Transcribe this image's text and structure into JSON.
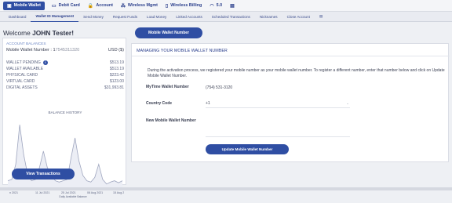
{
  "top_nav": {
    "items": [
      {
        "icon": "wallet-icon",
        "glyph": "▣",
        "label": "Mobile Wallet",
        "active": true
      },
      {
        "icon": "card-icon",
        "glyph": "▭",
        "label": "Debit Card"
      },
      {
        "icon": "lock-icon",
        "glyph": "🔒",
        "label": "Account"
      },
      {
        "icon": "signal-icon",
        "glyph": "⁂",
        "label": "Wireless Mgmt"
      },
      {
        "icon": "phone-icon",
        "glyph": "▯",
        "label": "Wireless Billing"
      },
      {
        "icon": "wifi-icon",
        "glyph": "◠",
        "label": "5.0"
      },
      {
        "icon": "chat-icon",
        "glyph": "▤",
        "label": ""
      }
    ]
  },
  "sub_nav": {
    "items": [
      {
        "label": "Dashboard"
      },
      {
        "label": "Wallet ID Management",
        "active": true
      },
      {
        "label": "Send Money"
      },
      {
        "label": "Request Funds"
      },
      {
        "label": "Load Money"
      },
      {
        "label": "Linked Accounts"
      },
      {
        "label": "Scheduled Transactions"
      },
      {
        "label": "Nicknames"
      },
      {
        "label": "Close Account"
      },
      {
        "label": "▤",
        "icon": "chat-icon"
      }
    ]
  },
  "welcome": {
    "prefix": "Welcome ",
    "name": "JOHN Tester!"
  },
  "balances": {
    "heading": "ACCOUNT BALANCES",
    "mobile_wallet_label": "Mobile Wallet Number : 1",
    "mobile_wallet_value": "7545311320",
    "currency": "USD ($)",
    "rows": [
      {
        "label": "WALLET PENDING",
        "value": "$513.19",
        "info": true
      },
      {
        "label": "WALLET AVAILABLE",
        "value": "$513.19"
      },
      {
        "label": "PHYSICAL CARD",
        "value": "$223.42"
      },
      {
        "label": "VIRTUAL CARD",
        "value": "$123.00"
      },
      {
        "label": "DIGITAL ASSETS",
        "value": "$31,993.81"
      }
    ]
  },
  "balance_history": {
    "title": "BALANCE HISTORY"
  },
  "chart_data": {
    "type": "area",
    "title": "BALANCE HISTORY",
    "xlabel": "Daily Available Balance",
    "ylabel": "",
    "x_tick_labels": [
      "n 2021",
      "11 Jul 2021",
      "25 Jul 2021",
      "08 Aug 2021",
      "15 Aug 2021"
    ],
    "series": [
      {
        "values": [
          0.1,
          0.12,
          0.35,
          0.95,
          0.5,
          0.2,
          0.1,
          0.12,
          0.3,
          0.55,
          0.3,
          0.2,
          0.1,
          0.08,
          0.1,
          0.12,
          0.45,
          0.75,
          0.4,
          0.18,
          0.1,
          0.08,
          0.15,
          0.35,
          0.12,
          0.05,
          0.08,
          0.1,
          0.07,
          0.1
        ]
      }
    ],
    "grid": false,
    "legend": "none",
    "colors": [
      "#9fa6bf"
    ]
  },
  "view_transactions_label": "View Transactions",
  "tab_label": "Mobile Wallet Number",
  "main": {
    "title": "MANAGING YOUR MOBILE WALLET NUMBER",
    "description": "During the activation process, we registered your mobile number as your mobile wallet number. To register a different number, enter that number below and click on Update Mobile Wallet Number.",
    "mytime_label": "MyTime Wallet Number",
    "mytime_value": "(754) 531-3120",
    "country_label": "Country Code",
    "country_value": "+1",
    "new_label": "New Mobile Wallet Number",
    "new_value": "",
    "update_label": "Update Mobile Wallet Number"
  },
  "colors": {
    "primary": "#2f4ea3",
    "accent": "#6b86c4",
    "chart_fill": "#9fa6bf"
  }
}
